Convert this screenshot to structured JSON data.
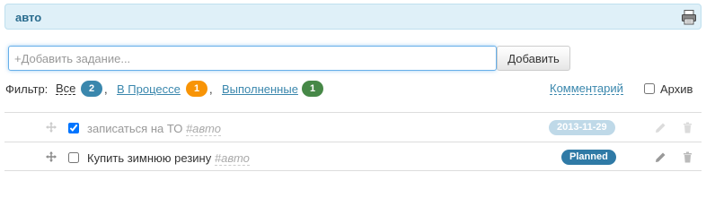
{
  "header": {
    "title": "авто",
    "print_icon": "printer-icon"
  },
  "add_task": {
    "placeholder": "+Добавить задание...",
    "button_label": "Добавить"
  },
  "filter": {
    "label": "Фильтр:",
    "items": [
      {
        "label": "Все",
        "count": "2",
        "badge_color": "#3a87ad",
        "active": true
      },
      {
        "label": "В Процессе",
        "count": "1",
        "badge_color": "#f89406",
        "active": false
      },
      {
        "label": "Выполненные",
        "count": "1",
        "badge_color": "#468847",
        "active": false
      }
    ],
    "separator": ",",
    "comment_label": "Комментарий",
    "archive_label": "Архив",
    "archive_checked": false
  },
  "tasks": [
    {
      "text": "записаться на ТО",
      "tag": "#авто",
      "checked": true,
      "status": "2013-11-29",
      "status_color": "#bfd9e8",
      "done": true
    },
    {
      "text": "Купить зимнюю резину",
      "tag": "#авто",
      "checked": false,
      "status": "Planned",
      "status_color": "#2f7aa6",
      "done": false
    }
  ],
  "icons": {
    "drag": "move-icon",
    "edit": "pencil-icon",
    "delete": "trash-icon"
  }
}
